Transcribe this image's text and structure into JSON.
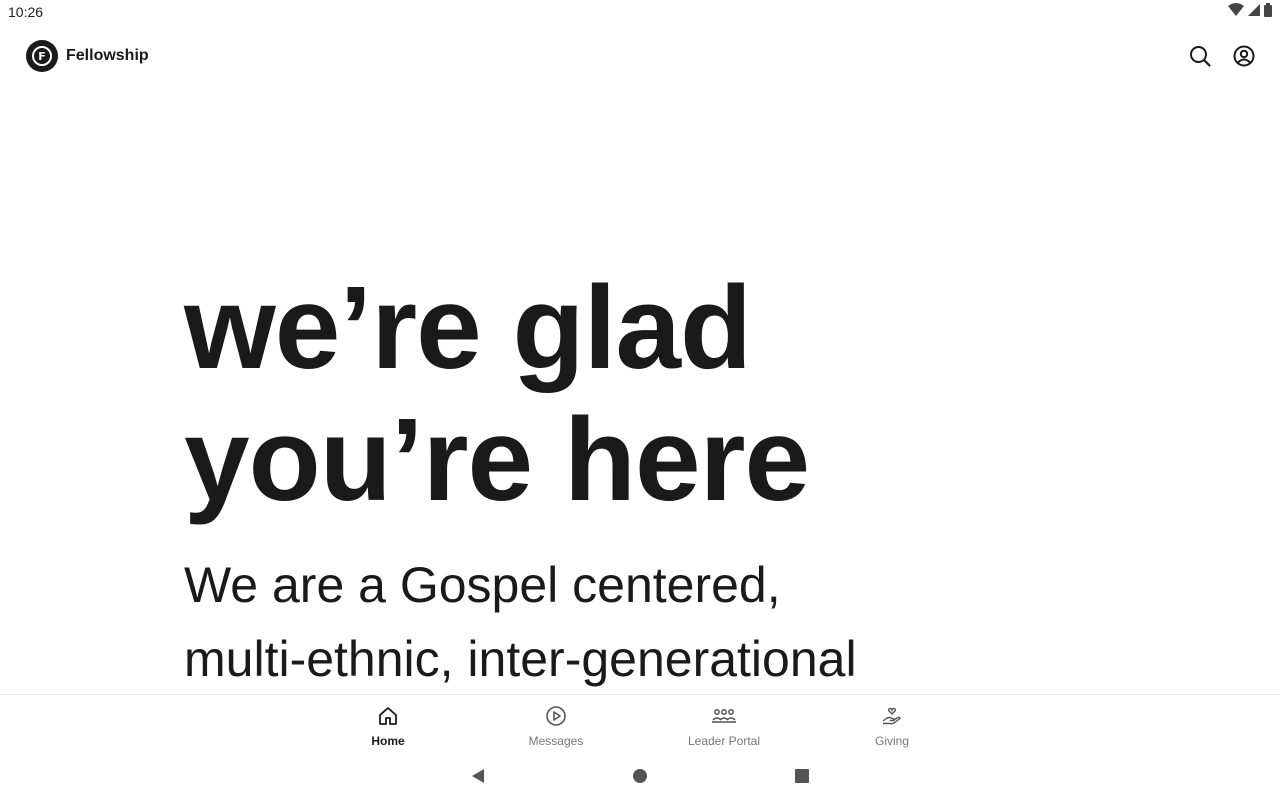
{
  "status_bar": {
    "time": "10:26",
    "icons": [
      "wifi-icon",
      "signal-icon",
      "battery-icon"
    ]
  },
  "app_bar": {
    "logo_letter": "F",
    "title": "Fellowship",
    "actions": [
      "search-icon",
      "account-icon"
    ]
  },
  "hero": {
    "title_line1": "we’re glad",
    "title_line2": "you’re here",
    "body_line1": "We are a Gospel centered,",
    "body_line2": "multi-ethnic, inter-generational"
  },
  "bottom_nav": {
    "items": [
      {
        "label": "Home",
        "icon": "home-icon",
        "active": true
      },
      {
        "label": "Messages",
        "icon": "play-circle-icon",
        "active": false
      },
      {
        "label": "Leader Portal",
        "icon": "group-icon",
        "active": false
      },
      {
        "label": "Giving",
        "icon": "giving-hand-heart-icon",
        "active": false
      }
    ]
  },
  "system_nav": [
    "back-icon",
    "home-circle-icon",
    "recents-square-icon"
  ],
  "colors": {
    "text": "#1a1a1a",
    "inactive": "#777777",
    "background": "#ffffff",
    "divider": "#ececec"
  }
}
